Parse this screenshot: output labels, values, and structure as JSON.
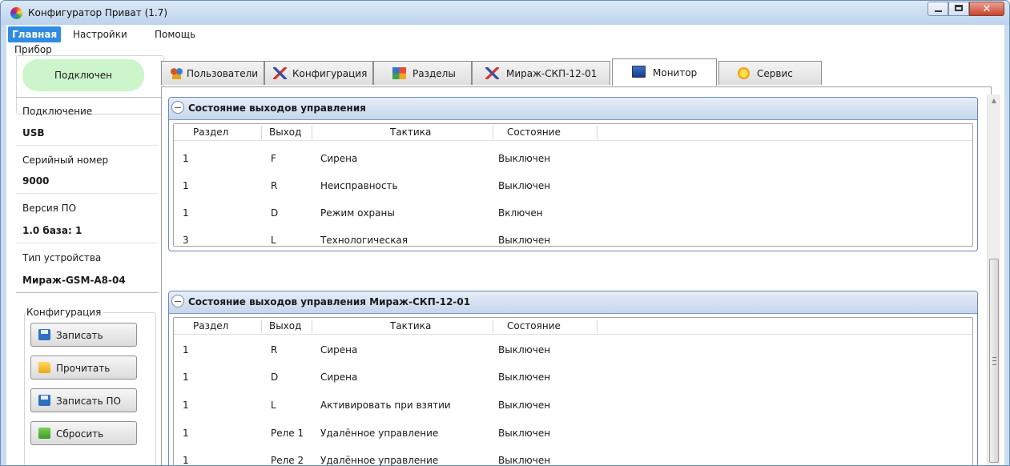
{
  "window": {
    "title": "Конфигуратор Приват (1.7)"
  },
  "menu": [
    "Главная",
    "Настройки",
    "Помощь"
  ],
  "sidebar": {
    "device_group": "Прибор",
    "status": "Подключен",
    "info": [
      {
        "label": "Подключение",
        "value": "USB"
      },
      {
        "label": "Серийный номер",
        "value": "9000"
      },
      {
        "label": "Версия ПО",
        "value": "1.0 база: 1"
      },
      {
        "label": "Тип устройства",
        "value": "Мираж-GSM-A8-04"
      }
    ],
    "config_group": "Конфигурация",
    "buttons": [
      "Записать",
      "Прочитать",
      "Записать ПО",
      "Сбросить"
    ]
  },
  "tabs": [
    {
      "label": "Пользователи",
      "icon": "users-icon"
    },
    {
      "label": "Конфигурация",
      "icon": "tools-icon"
    },
    {
      "label": "Разделы",
      "icon": "partitions-icon"
    },
    {
      "label": "Мираж-СКП-12-01",
      "icon": "tools-icon"
    },
    {
      "label": "Монитор",
      "icon": "monitor-icon",
      "active": true
    },
    {
      "label": "Сервис",
      "icon": "service-icon"
    }
  ],
  "columns": [
    "Раздел",
    "Выход",
    "Тактика",
    "Состояние"
  ],
  "sections": [
    {
      "title": "Состояние выходов управления",
      "rows": [
        [
          "1",
          "F",
          "Сирена",
          "Выключен"
        ],
        [
          "1",
          "R",
          "Неисправность",
          "Выключен"
        ],
        [
          "1",
          "D",
          "Режим охраны",
          "Включен"
        ],
        [
          "3",
          "L",
          "Технологическая",
          "Выключен"
        ]
      ]
    },
    {
      "title": "Состояние выходов управления Мираж-СКП-12-01",
      "rows": [
        [
          "1",
          "R",
          "Сирена",
          "Выключен"
        ],
        [
          "1",
          "D",
          "Сирена",
          "Выключен"
        ],
        [
          "1",
          "L",
          "Активировать при взятии",
          "Выключен"
        ],
        [
          "1",
          "Реле 1",
          "Удалённое управление",
          "Выключен"
        ],
        [
          "1",
          "Реле 2",
          "Удалённое управление",
          "Выключен"
        ]
      ]
    }
  ]
}
